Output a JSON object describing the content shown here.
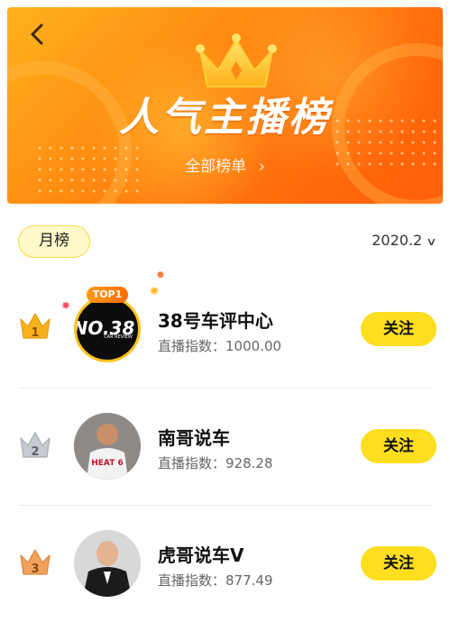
{
  "banner": {
    "back_icon": "chevron-left-icon",
    "title": "人气主播榜",
    "all_lists_label": "全部榜单",
    "all_lists_chevron": "›"
  },
  "filters": {
    "period_label": "月榜",
    "date_label": "2020.2",
    "date_caret": "∨"
  },
  "list": [
    {
      "rank": "1",
      "badge": "TOP1",
      "name": "38号车评中心",
      "index_label": "直播指数：",
      "index_value": "1000.00",
      "follow_label": "关注",
      "avatar_text": "NO.38",
      "avatar_subtext": "CAR REVIEW"
    },
    {
      "rank": "2",
      "name": "南哥说车",
      "index_label": "直播指数：",
      "index_value": "928.28",
      "follow_label": "关注",
      "avatar_jersey": "HEAT 6"
    },
    {
      "rank": "3",
      "name": "虎哥说车V",
      "index_label": "直播指数：",
      "index_value": "877.49",
      "follow_label": "关注"
    }
  ],
  "colors": {
    "banner_orange": "#ff6a0c",
    "follow_yellow": "#ffdd1f",
    "gold": "#f6b21b",
    "silver": "#b9bcc4",
    "bronze": "#e58a3a"
  }
}
